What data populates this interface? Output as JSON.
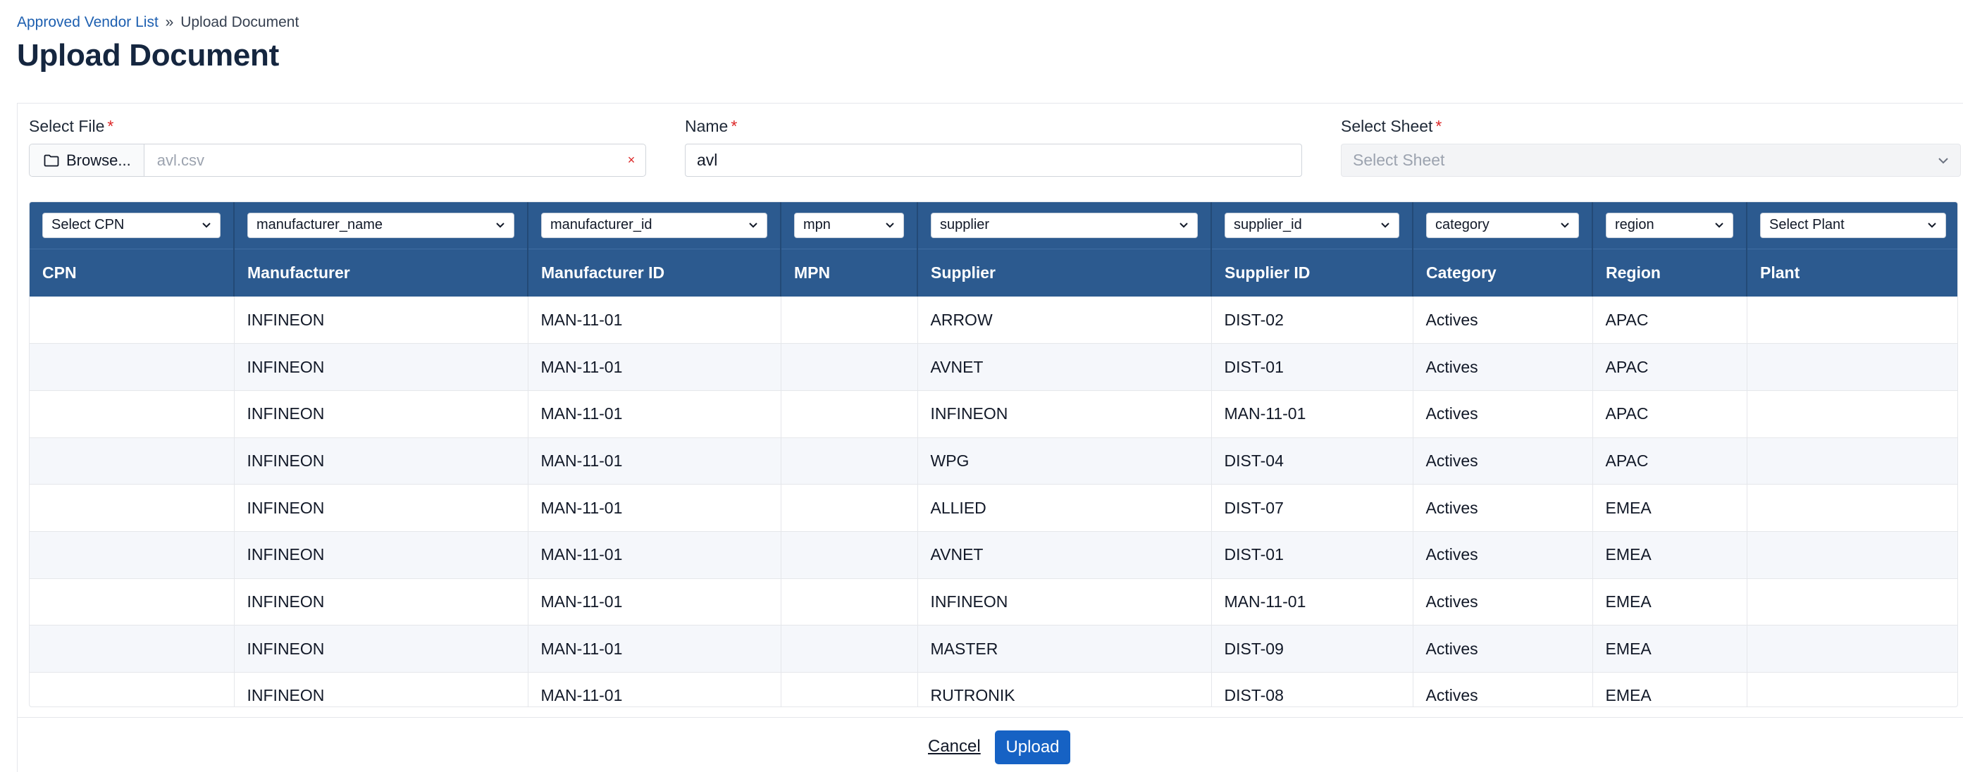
{
  "breadcrumb": {
    "parent": "Approved Vendor List",
    "separator": "»",
    "current": "Upload Document"
  },
  "page_title": "Upload Document",
  "form": {
    "file": {
      "label": "Select File",
      "required_mark": "*",
      "browse_label": "Browse...",
      "file_name": "avl.csv",
      "clear_symbol": "×"
    },
    "name": {
      "label": "Name",
      "required_mark": "*",
      "value": "avl"
    },
    "sheet": {
      "label": "Select Sheet",
      "required_mark": "*",
      "placeholder": "Select Sheet"
    }
  },
  "table": {
    "mappings": [
      "Select CPN",
      "manufacturer_name",
      "manufacturer_id",
      "mpn",
      "supplier",
      "supplier_id",
      "category",
      "region",
      "Select Plant"
    ],
    "headers": [
      "CPN",
      "Manufacturer",
      "Manufacturer ID",
      "MPN",
      "Supplier",
      "Supplier ID",
      "Category",
      "Region",
      "Plant"
    ],
    "rows": [
      [
        "",
        "INFINEON",
        "MAN-11-01",
        "",
        "ARROW",
        "DIST-02",
        "Actives",
        "APAC",
        ""
      ],
      [
        "",
        "INFINEON",
        "MAN-11-01",
        "",
        "AVNET",
        "DIST-01",
        "Actives",
        "APAC",
        ""
      ],
      [
        "",
        "INFINEON",
        "MAN-11-01",
        "",
        "INFINEON",
        "MAN-11-01",
        "Actives",
        "APAC",
        ""
      ],
      [
        "",
        "INFINEON",
        "MAN-11-01",
        "",
        "WPG",
        "DIST-04",
        "Actives",
        "APAC",
        ""
      ],
      [
        "",
        "INFINEON",
        "MAN-11-01",
        "",
        "ALLIED",
        "DIST-07",
        "Actives",
        "EMEA",
        ""
      ],
      [
        "",
        "INFINEON",
        "MAN-11-01",
        "",
        "AVNET",
        "DIST-01",
        "Actives",
        "EMEA",
        ""
      ],
      [
        "",
        "INFINEON",
        "MAN-11-01",
        "",
        "INFINEON",
        "MAN-11-01",
        "Actives",
        "EMEA",
        ""
      ],
      [
        "",
        "INFINEON",
        "MAN-11-01",
        "",
        "MASTER",
        "DIST-09",
        "Actives",
        "EMEA",
        ""
      ],
      [
        "",
        "INFINEON",
        "MAN-11-01",
        "",
        "RUTRONIK",
        "DIST-08",
        "Actives",
        "EMEA",
        ""
      ]
    ]
  },
  "actions": {
    "cancel_label": "Cancel",
    "upload_label": "Upload"
  },
  "colors": {
    "accent": "#1662c4",
    "table_header": "#2c5a8f",
    "link": "#1d5fb0",
    "required": "#dc2626",
    "title": "#15263f"
  },
  "icons": {
    "browse": "folder-icon",
    "select": "chevron-down-icon",
    "clear": "close-icon"
  }
}
